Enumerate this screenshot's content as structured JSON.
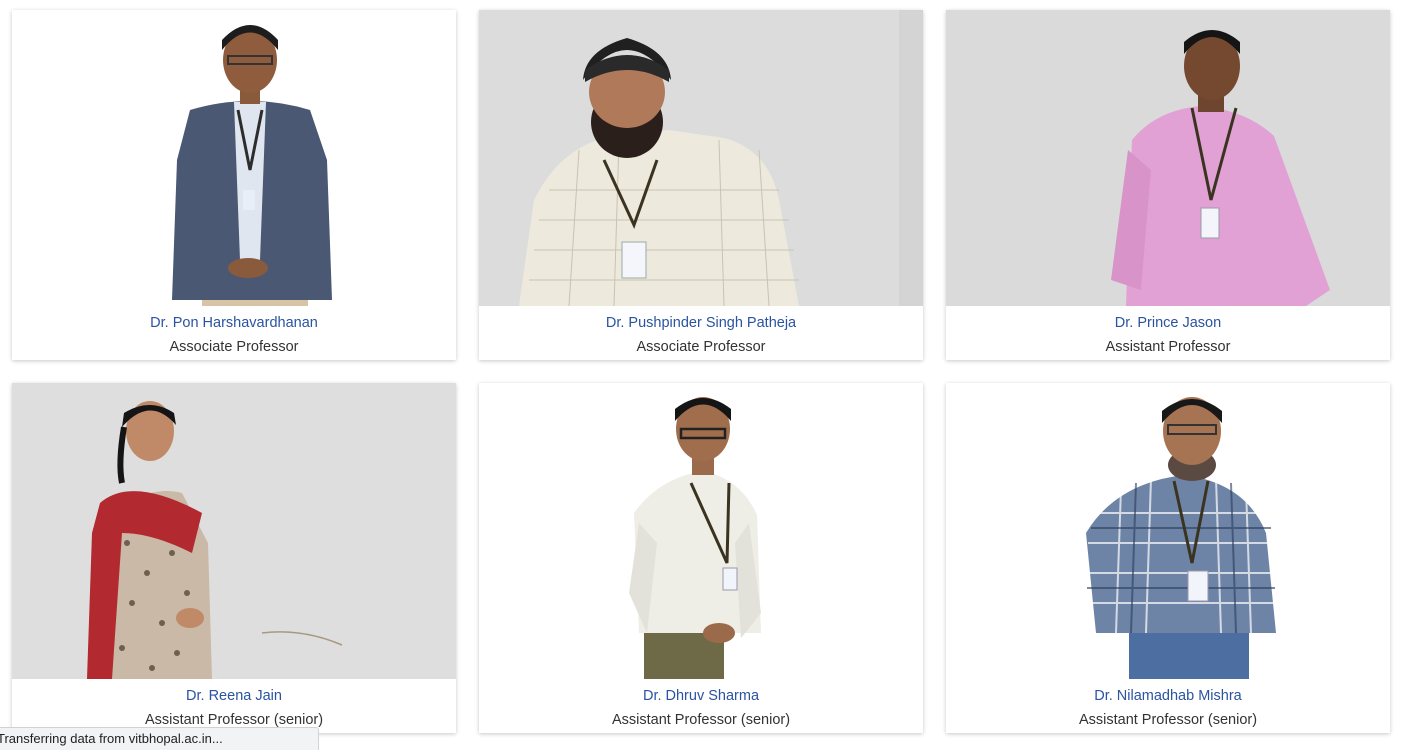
{
  "faculty": [
    {
      "name": "Dr. Pon Harshavardhanan",
      "designation": "Associate Professor"
    },
    {
      "name": "Dr. Pushpinder Singh Patheja",
      "designation": "Associate Professor"
    },
    {
      "name": "Dr. Prince Jason",
      "designation": "Assistant Professor"
    },
    {
      "name": "Dr. Reena Jain",
      "designation": "Assistant Professor (senior)"
    },
    {
      "name": "Dr. Dhruv Sharma",
      "designation": "Assistant Professor (senior)"
    },
    {
      "name": "Dr. Nilamadhab Mishra",
      "designation": "Assistant Professor (senior)"
    }
  ],
  "status_bar": {
    "text": "Transferring data from vitbhopal.ac.in..."
  },
  "colors": {
    "name_link": "#2a53a2",
    "designation_text": "#333333",
    "card_background": "#ffffff"
  }
}
